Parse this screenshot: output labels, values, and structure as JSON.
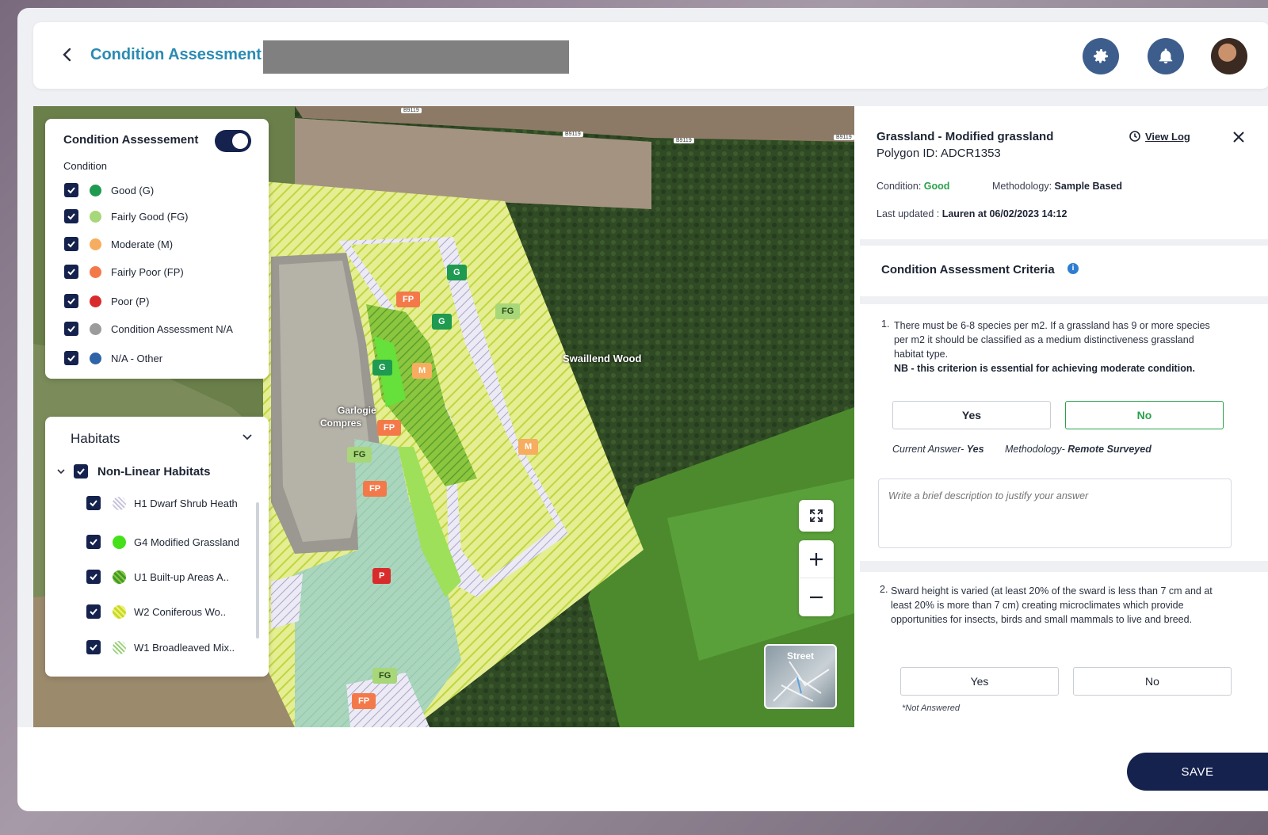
{
  "header": {
    "title": "Condition Assessment:",
    "back_icon": "chevron-left-icon",
    "settings_icon": "gear-icon",
    "notifications_icon": "bell-icon"
  },
  "map": {
    "place_label": "Swaillend Wood",
    "site_label_1": "Garlogie",
    "site_label_2": "Compres",
    "roads": [
      "B9119",
      "B9119",
      "B9119",
      "B9119"
    ],
    "street_toggle_label": "Street",
    "markers": [
      {
        "code": "G",
        "level": "good"
      },
      {
        "code": "FP",
        "level": "fairly-poor"
      },
      {
        "code": "G",
        "level": "good"
      },
      {
        "code": "FG",
        "level": "fairly-good"
      },
      {
        "code": "G",
        "level": "good"
      },
      {
        "code": "M",
        "level": "moderate"
      },
      {
        "code": "FP",
        "level": "fairly-poor"
      },
      {
        "code": "FG",
        "level": "fairly-good"
      },
      {
        "code": "M",
        "level": "moderate"
      },
      {
        "code": "FP",
        "level": "fairly-poor"
      },
      {
        "code": "P",
        "level": "poor"
      },
      {
        "code": "FG",
        "level": "fairly-good"
      },
      {
        "code": "FP",
        "level": "fairly-poor"
      }
    ]
  },
  "condition_legend": {
    "title": "Condition Assessement",
    "toggle_on": true,
    "subtitle": "Condition",
    "items": [
      {
        "label": "Good (G)",
        "color": "#1e9a51",
        "checked": true
      },
      {
        "label": "Fairly Good (FG)",
        "color": "#a8d77a",
        "checked": true
      },
      {
        "label": "Moderate (M)",
        "color": "#f7ad5f",
        "checked": true
      },
      {
        "label": "Fairly Poor (FP)",
        "color": "#f4794a",
        "checked": true
      },
      {
        "label": "Poor (P)",
        "color": "#d92b2b",
        "checked": true
      },
      {
        "label": "Condition Assessment N/A",
        "color": "#9b9b9b",
        "checked": true
      },
      {
        "label": "N/A - Other",
        "color": "#2f64a8",
        "checked": true
      }
    ]
  },
  "habitats": {
    "title": "Habitats",
    "group_label": "Non-Linear Habitats",
    "items": [
      {
        "label": "H1 Dwarf Shrub Heath",
        "swatch": "hatch-lavender",
        "checked": true
      },
      {
        "label": "G4 Modified Grassland",
        "swatch": "solid-green",
        "checked": true
      },
      {
        "label": "U1 Built-up Areas A..",
        "swatch": "hatch-green",
        "checked": true
      },
      {
        "label": "W2 Coniferous Wo..",
        "swatch": "hatch-yellow",
        "checked": true
      },
      {
        "label": "W1 Broadleaved Mix..",
        "swatch": "hatch-light-green",
        "checked": true
      }
    ]
  },
  "panel": {
    "title": "Grassland - Modified grassland",
    "polygon_id": "Polygon ID: ADCR1353",
    "view_log_label": "View Log",
    "condition_label": "Condition:",
    "condition_value": "Good",
    "methodology_label": "Methodology:",
    "methodology_value": "Sample Based",
    "last_updated_label": "Last updated :",
    "last_updated_value": "Lauren at 06/02/2023 14:12",
    "criteria_title": "Condition Assessment Criteria",
    "q1": {
      "number": "1.",
      "text": "There must be 6-8 species per m2. If a grassland has 9 or more species per m2 it should be classified as a medium distinctiveness grassland habitat type.",
      "note": "NB - this criterion is essential for achieving moderate condition.",
      "yes_label": "Yes",
      "no_label": "No",
      "current_answer_label": "Current Answer-",
      "current_answer_value": "Yes",
      "methodology_label": "Methodology-",
      "methodology_value": "Remote Surveyed",
      "justify_placeholder": "Write a brief description to justify your answer"
    },
    "q2": {
      "number": "2.",
      "text": "Sward height is varied (at least 20% of the sward is less than 7 cm and at least 20% is more than 7 cm) creating microclimates which provide opportunities for insects, birds and small mammals to live and breed.",
      "yes_label": "Yes",
      "no_label": "No",
      "status": "*Not Answered"
    }
  },
  "footer": {
    "save_label": "SAVE"
  }
}
